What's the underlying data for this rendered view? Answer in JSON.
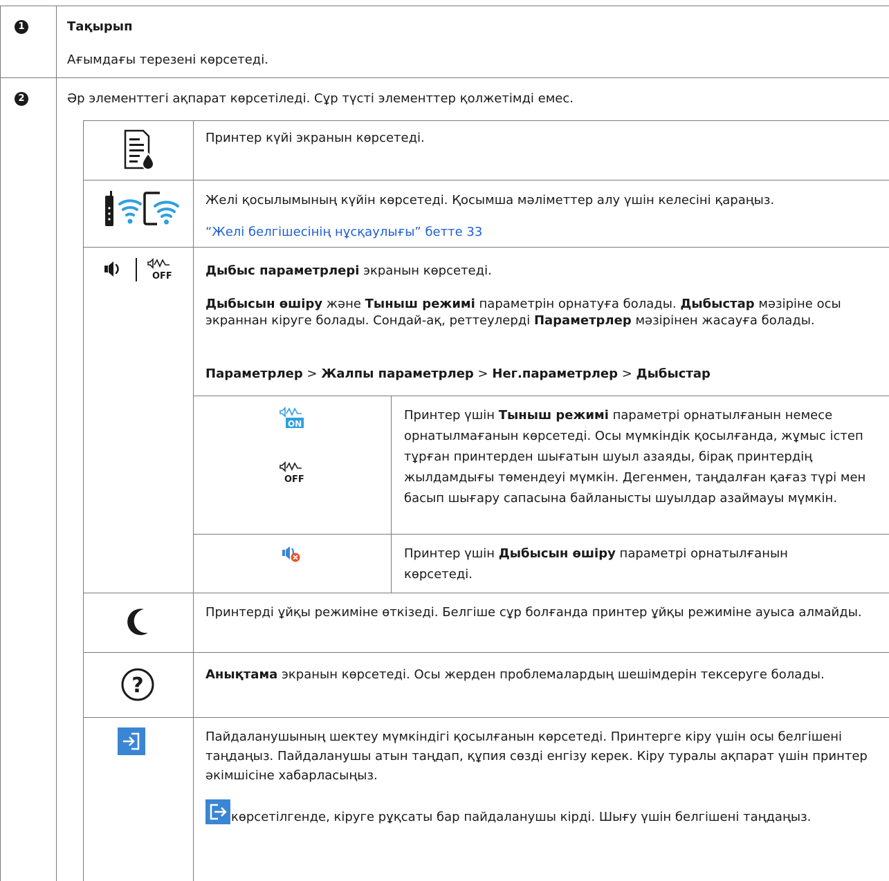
{
  "row1": {
    "number": "1",
    "title": "Тақырып",
    "description": "Ағымдағы терезені көрсетеді."
  },
  "row2": {
    "number": "2",
    "intro": "Әр элементтегі ақпарат көрсетіледі. Сұр түсті элементтер қолжетімді емес.",
    "printer_status": {
      "icon": "printer-ink-status-icon",
      "text": "Принтер күйі экранын көрсетеді."
    },
    "network": {
      "icons": [
        "wifi-router-icon",
        "wifi-phone-icon"
      ],
      "text": "Желі қосылымының күйін көрсетеді. Қосымша мәліметтер алу үшін келесіні қараңыз.",
      "link": "“Желі белгішесінің нұсқаулығы” бетте 33"
    },
    "sound": {
      "icons": [
        "speaker-icon",
        "quiet-mode-off-icon"
      ],
      "p1_bold": "Дыбыс параметрлері",
      "p1_rest": " экранын көрсетеді.",
      "p2_a_bold": "Дыбысын өшіру",
      "p2_b": " және ",
      "p2_c_bold": "Тыныш режимі",
      "p2_d": " параметрін орнатуға болады. ",
      "p2_e_bold": "Дыбыстар",
      "p2_f": " мәзіріне осы экраннан кіруге болады. Сондай-ақ, реттеулерді ",
      "p2_g_bold": "Параметрлер",
      "p2_h": " мәзірінен жасауға болады.",
      "path": [
        "Параметрлер",
        "Жалпы параметрлер",
        "Нег.параметрлер",
        "Дыбыстар"
      ],
      "path_sep": ">",
      "quiet": {
        "icons": [
          "quiet-mode-on-icon",
          "quiet-mode-off-icon"
        ],
        "on_label": "ON",
        "off_label": "OFF",
        "a": "Принтер үшін ",
        "b_bold": "Тыныш режимі",
        "c": " параметрі орнатылғанын немесе орнатылмағанын көрсетеді. Осы мүмкіндік қосылғанда, жұмыс істеп тұрған принтерден шығатын шуыл азаяды, бірақ принтердің жылдамдығы төмендеуі мүмкін. Дегенмен, таңдалған қағаз түрі мен басып шығару сапасына байланысты шуылдар азаймауы мүмкін."
      },
      "mute": {
        "icon": "mute-speaker-icon",
        "a": "Принтер үшін ",
        "b_bold": "Дыбысын өшіру",
        "c": " параметрі орнатылғанын көрсетеді."
      }
    },
    "sleep": {
      "icon": "moon-sleep-icon",
      "text": "Принтерді ұйқы режиміне өткізеді. Белгіше сұр болғанда принтер ұйқы режиміне ауыса алмайды."
    },
    "help": {
      "icon": "help-question-icon",
      "bold": "Анықтама",
      "text": " экранын көрсетеді. Осы жерден проблемалардың шешімдерін тексеруге болады."
    },
    "login": {
      "icon": "login-icon",
      "inline_icon": "logout-icon",
      "p1": "Пайдаланушының шектеу мүмкіндігі қосылғанын көрсетеді. Принтерге кіру үшін осы белгішені таңдаңыз. Пайдаланушы атын таңдап, құпия сөзді енгізу керек. Кіру туралы ақпарат үшін принтер әкімшісіне хабарласыңыз.",
      "p2": " көрсетілгенде, кіруге рұқсаты бар пайдаланушы кірді. Шығу үшін белгішені таңдаңыз."
    }
  },
  "colors": {
    "link": "#1f5fd6",
    "icon_blue": "#2f9fe0",
    "tile_blue": "#3a86d4",
    "mute_red": "#e8542a",
    "border": "#7a7a7a"
  }
}
